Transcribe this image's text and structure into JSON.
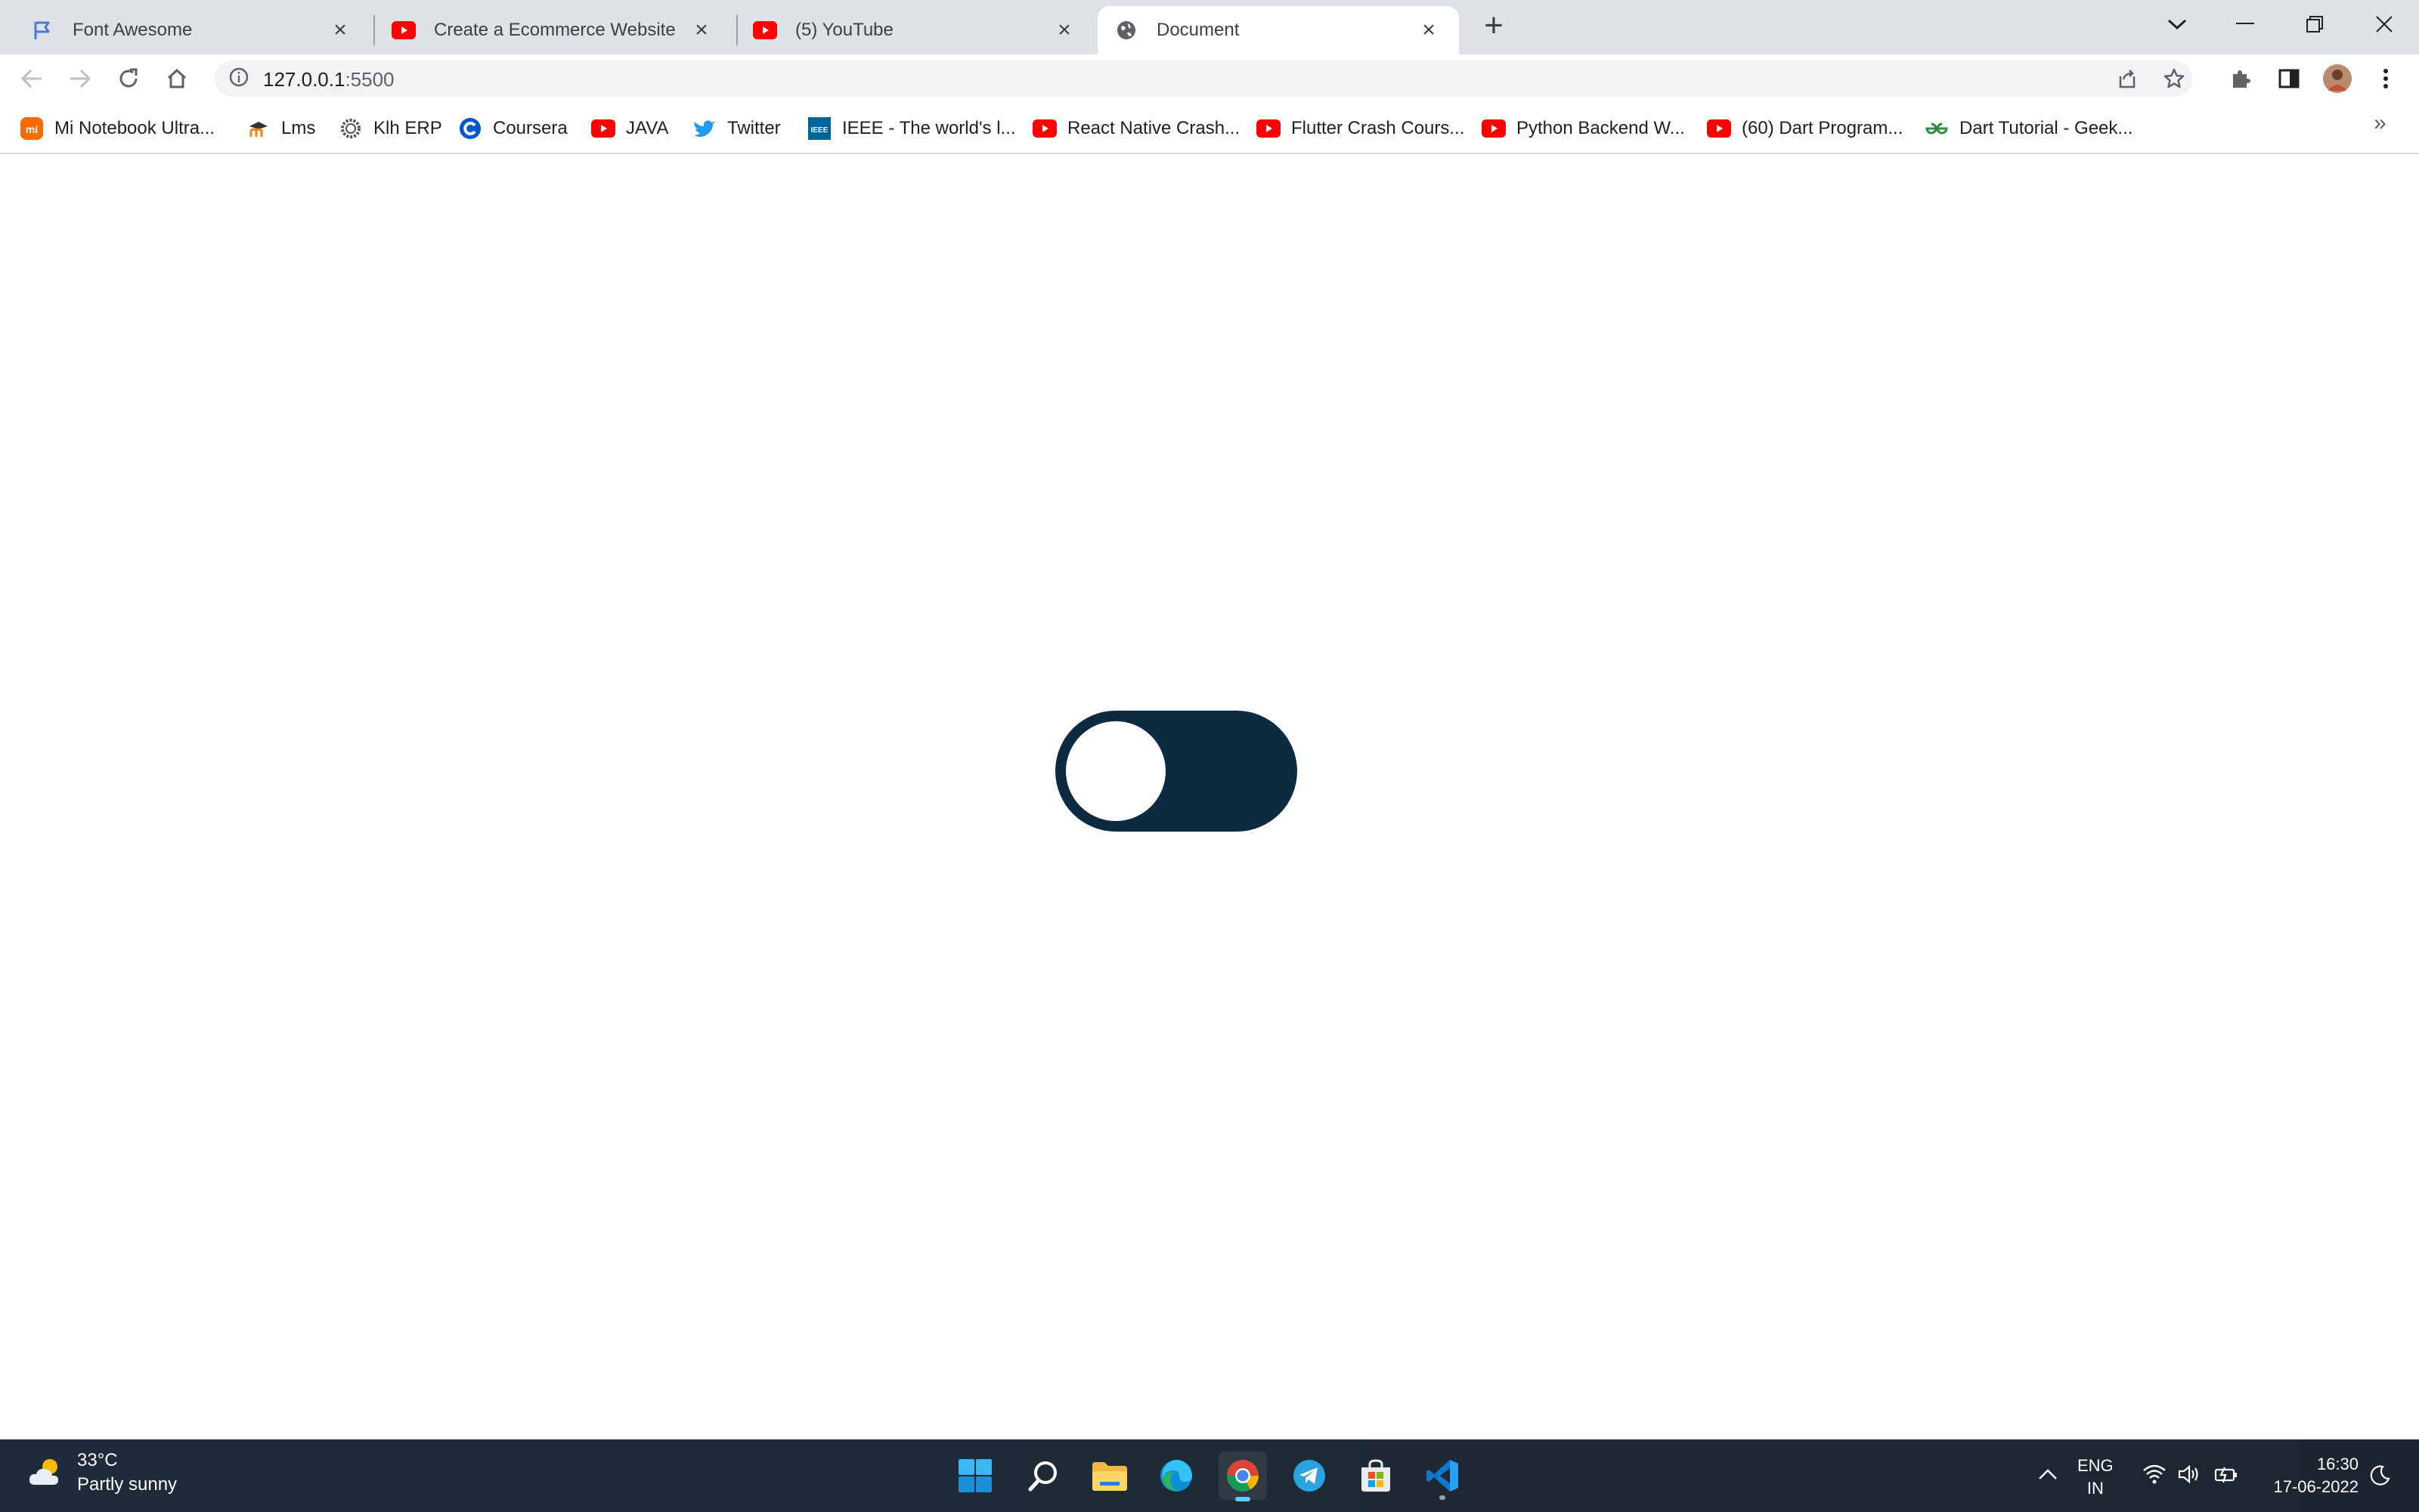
{
  "browser": {
    "tabs": [
      {
        "title": "Font Awesome",
        "icon": "flag-icon",
        "active": false
      },
      {
        "title": "Create a Ecommerce Website Usi",
        "icon": "youtube-icon",
        "active": false
      },
      {
        "title": "(5) YouTube",
        "icon": "youtube-icon",
        "active": false
      },
      {
        "title": "Document",
        "icon": "globe-icon",
        "active": true
      }
    ],
    "address": {
      "host": "127.0.0.1",
      "port": ":5500"
    },
    "bookmarks": [
      {
        "label": "Mi Notebook Ultra...",
        "icon": "mi-icon"
      },
      {
        "label": "Lms",
        "icon": "moodle-icon"
      },
      {
        "label": "Klh ERP",
        "icon": "gear-logo-icon"
      },
      {
        "label": "Coursera",
        "icon": "coursera-icon"
      },
      {
        "label": "JAVA",
        "icon": "youtube-icon"
      },
      {
        "label": "Twitter",
        "icon": "twitter-icon"
      },
      {
        "label": "IEEE - The world's l...",
        "icon": "ieee-icon"
      },
      {
        "label": "React Native Crash...",
        "icon": "youtube-icon"
      },
      {
        "label": "Flutter Crash Cours...",
        "icon": "youtube-icon"
      },
      {
        "label": "Python Backend W...",
        "icon": "youtube-icon"
      },
      {
        "label": "(60) Dart Program...",
        "icon": "youtube-icon"
      },
      {
        "label": "Dart Tutorial - Geek...",
        "icon": "geeksforgeeks-icon"
      }
    ],
    "bookmarks_overflow": "»"
  },
  "page": {
    "toggle": {
      "state": "off",
      "track_color": "#0d2b40",
      "knob_color": "#ffffff"
    }
  },
  "taskbar": {
    "weather": {
      "temp": "33°C",
      "condition": "Partly sunny"
    },
    "apps": [
      "windows-start-icon",
      "search-icon",
      "file-explorer-icon",
      "edge-icon",
      "chrome-icon",
      "telegram-icon",
      "microsoft-store-icon",
      "vscode-icon"
    ],
    "language": {
      "line1": "ENG",
      "line2": "IN"
    },
    "clock": {
      "time": "16:30",
      "date": "17-06-2022"
    }
  }
}
